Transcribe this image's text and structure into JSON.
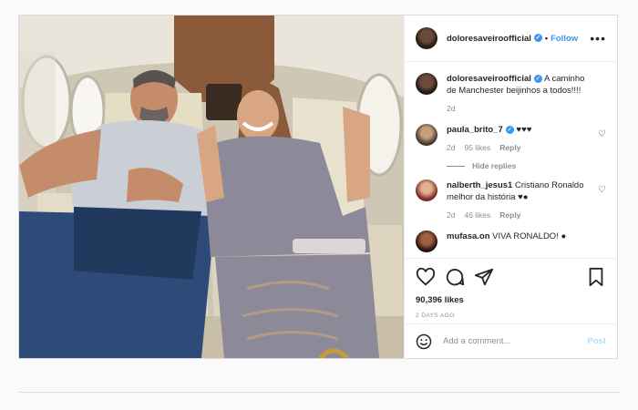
{
  "photo": {
    "description_icon": "photo-cabin-scene"
  },
  "header": {
    "username": "doloresaveiroofficial",
    "follow_label": "Follow",
    "separator": "•",
    "more": "•••"
  },
  "caption": {
    "username": "doloresaveiroofficial",
    "text": "A caminho de Manchester beijinhos a todos!!!!",
    "age": "2d"
  },
  "comments": [
    {
      "username": "paula_brito_7",
      "verified": true,
      "text": "♥♥♥",
      "age": "2d",
      "likes": "95 likes",
      "reply": "Reply",
      "hide": "Hide replies"
    },
    {
      "username": "nalberth_jesus1",
      "verified": false,
      "text": "Cristiano Ronaldo melhor da história ♥●",
      "age": "2d",
      "likes": "46 likes",
      "reply": "Reply"
    },
    {
      "username": "mufasa.on",
      "text": "VIVA RONALDO! ●"
    }
  ],
  "stats": {
    "likes": "90,396 likes",
    "posted": "2 DAYS AGO"
  },
  "add_comment": {
    "placeholder": "Add a comment...",
    "post_label": "Post"
  },
  "colors": {
    "accent": "#3897f0",
    "post_disabled": "#b2dffc"
  }
}
